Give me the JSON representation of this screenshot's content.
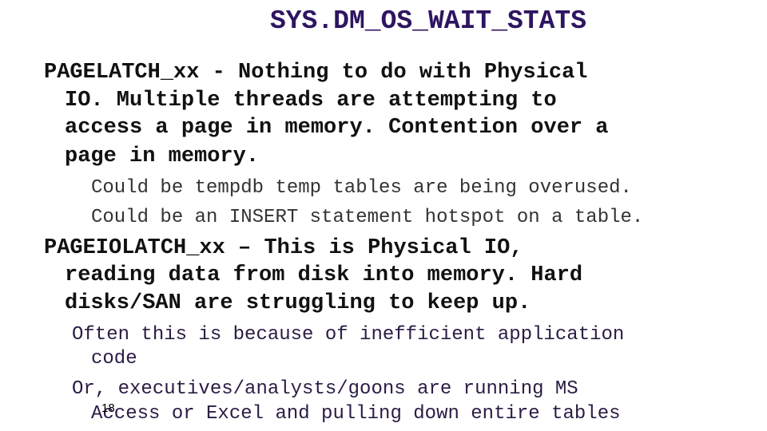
{
  "slide": {
    "title": "SYS.DM_OS_WAIT_STATS",
    "sections": [
      {
        "lines": [
          "PAGELATCH_xx - Nothing to do with Physical",
          "IO. Multiple threads are attempting to",
          "access a page in memory. Contention over a",
          "page in memory."
        ],
        "sub_lines": [
          "Could be tempdb temp tables are being overused.",
          "Could be an INSERT statement hotspot on a table."
        ]
      },
      {
        "lines": [
          "PAGEIOLATCH_xx – This is Physical IO,",
          "reading data from disk into memory. Hard",
          "disks/SAN are struggling to keep up."
        ],
        "sub_lines": [
          "Often this is because of inefficient application",
          "code",
          "Or, executives/analysts/goons are running MS",
          "Access or Excel and pulling down entire tables"
        ]
      }
    ],
    "page_number": "18"
  }
}
